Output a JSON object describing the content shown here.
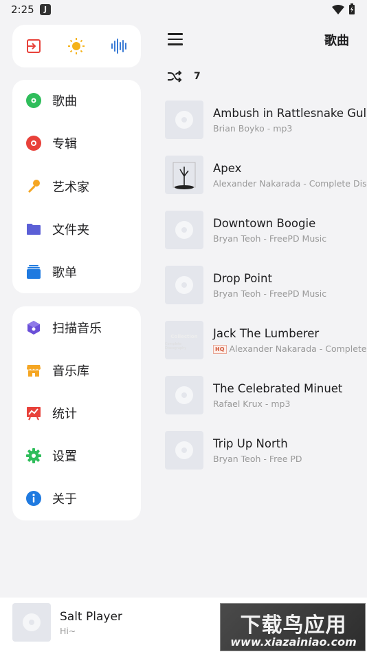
{
  "status_bar": {
    "time": "2:25",
    "app_badge": "J"
  },
  "quick_actions": [
    {
      "icon": "exit-icon",
      "color": "#e8413a"
    },
    {
      "icon": "sun-icon",
      "color": "#f5b31b"
    },
    {
      "icon": "equalizer-icon",
      "color": "#3a7bd5"
    }
  ],
  "drawer": {
    "library_items": [
      {
        "label": "歌曲",
        "icon": "song-disc-icon",
        "color": "#2fbd5b"
      },
      {
        "label": "专辑",
        "icon": "album-disc-icon",
        "color": "#e8413a"
      },
      {
        "label": "艺术家",
        "icon": "microphone-icon",
        "color": "#f5a623"
      },
      {
        "label": "文件夹",
        "icon": "folder-icon",
        "color": "#5b5fd6"
      },
      {
        "label": "歌单",
        "icon": "playlist-icon",
        "color": "#1f7ae0"
      }
    ],
    "tool_items": [
      {
        "label": "扫描音乐",
        "icon": "scan-cube-icon",
        "color": "#6a4fd8"
      },
      {
        "label": "音乐库",
        "icon": "store-icon",
        "color": "#f5a623"
      },
      {
        "label": "统计",
        "icon": "stats-icon",
        "color": "#e8413a"
      },
      {
        "label": "设置",
        "icon": "gear-icon",
        "color": "#2fbd5b"
      },
      {
        "label": "关于",
        "icon": "info-icon",
        "color": "#1f7ae0"
      }
    ]
  },
  "header": {
    "title": "歌曲"
  },
  "list": {
    "count": "7",
    "songs": [
      {
        "title": "Ambush in Rattlesnake Gulch",
        "subtitle": "Brian Boyko - mp3",
        "hq": "",
        "art": "placeholder"
      },
      {
        "title": "Apex",
        "subtitle": "Alexander Nakarada - Complete Discography",
        "hq": "",
        "art": "apex"
      },
      {
        "title": "Downtown Boogie",
        "subtitle": "Bryan Teoh - FreePD Music",
        "hq": "",
        "art": "placeholder"
      },
      {
        "title": "Drop Point",
        "subtitle": "Bryan Teoh - FreePD Music",
        "hq": "",
        "art": "placeholder"
      },
      {
        "title": "Jack The Lumberer",
        "subtitle": "Alexander Nakarada - Complete Discography",
        "hq": "HQ",
        "art": "jack",
        "art_text_1": "Collection",
        "art_text_2": "Complete Discography"
      },
      {
        "title": "The Celebrated Minuet",
        "subtitle": "Rafael Krux - mp3",
        "hq": "",
        "art": "placeholder"
      },
      {
        "title": "Trip Up North",
        "subtitle": "Bryan Teoh - Free PD",
        "hq": "",
        "art": "placeholder"
      }
    ]
  },
  "player": {
    "title": "Salt Player",
    "subtitle": "Hi~"
  },
  "watermark": {
    "line1": "下载鸟应用",
    "line2": "www.xiazainiao.com"
  }
}
